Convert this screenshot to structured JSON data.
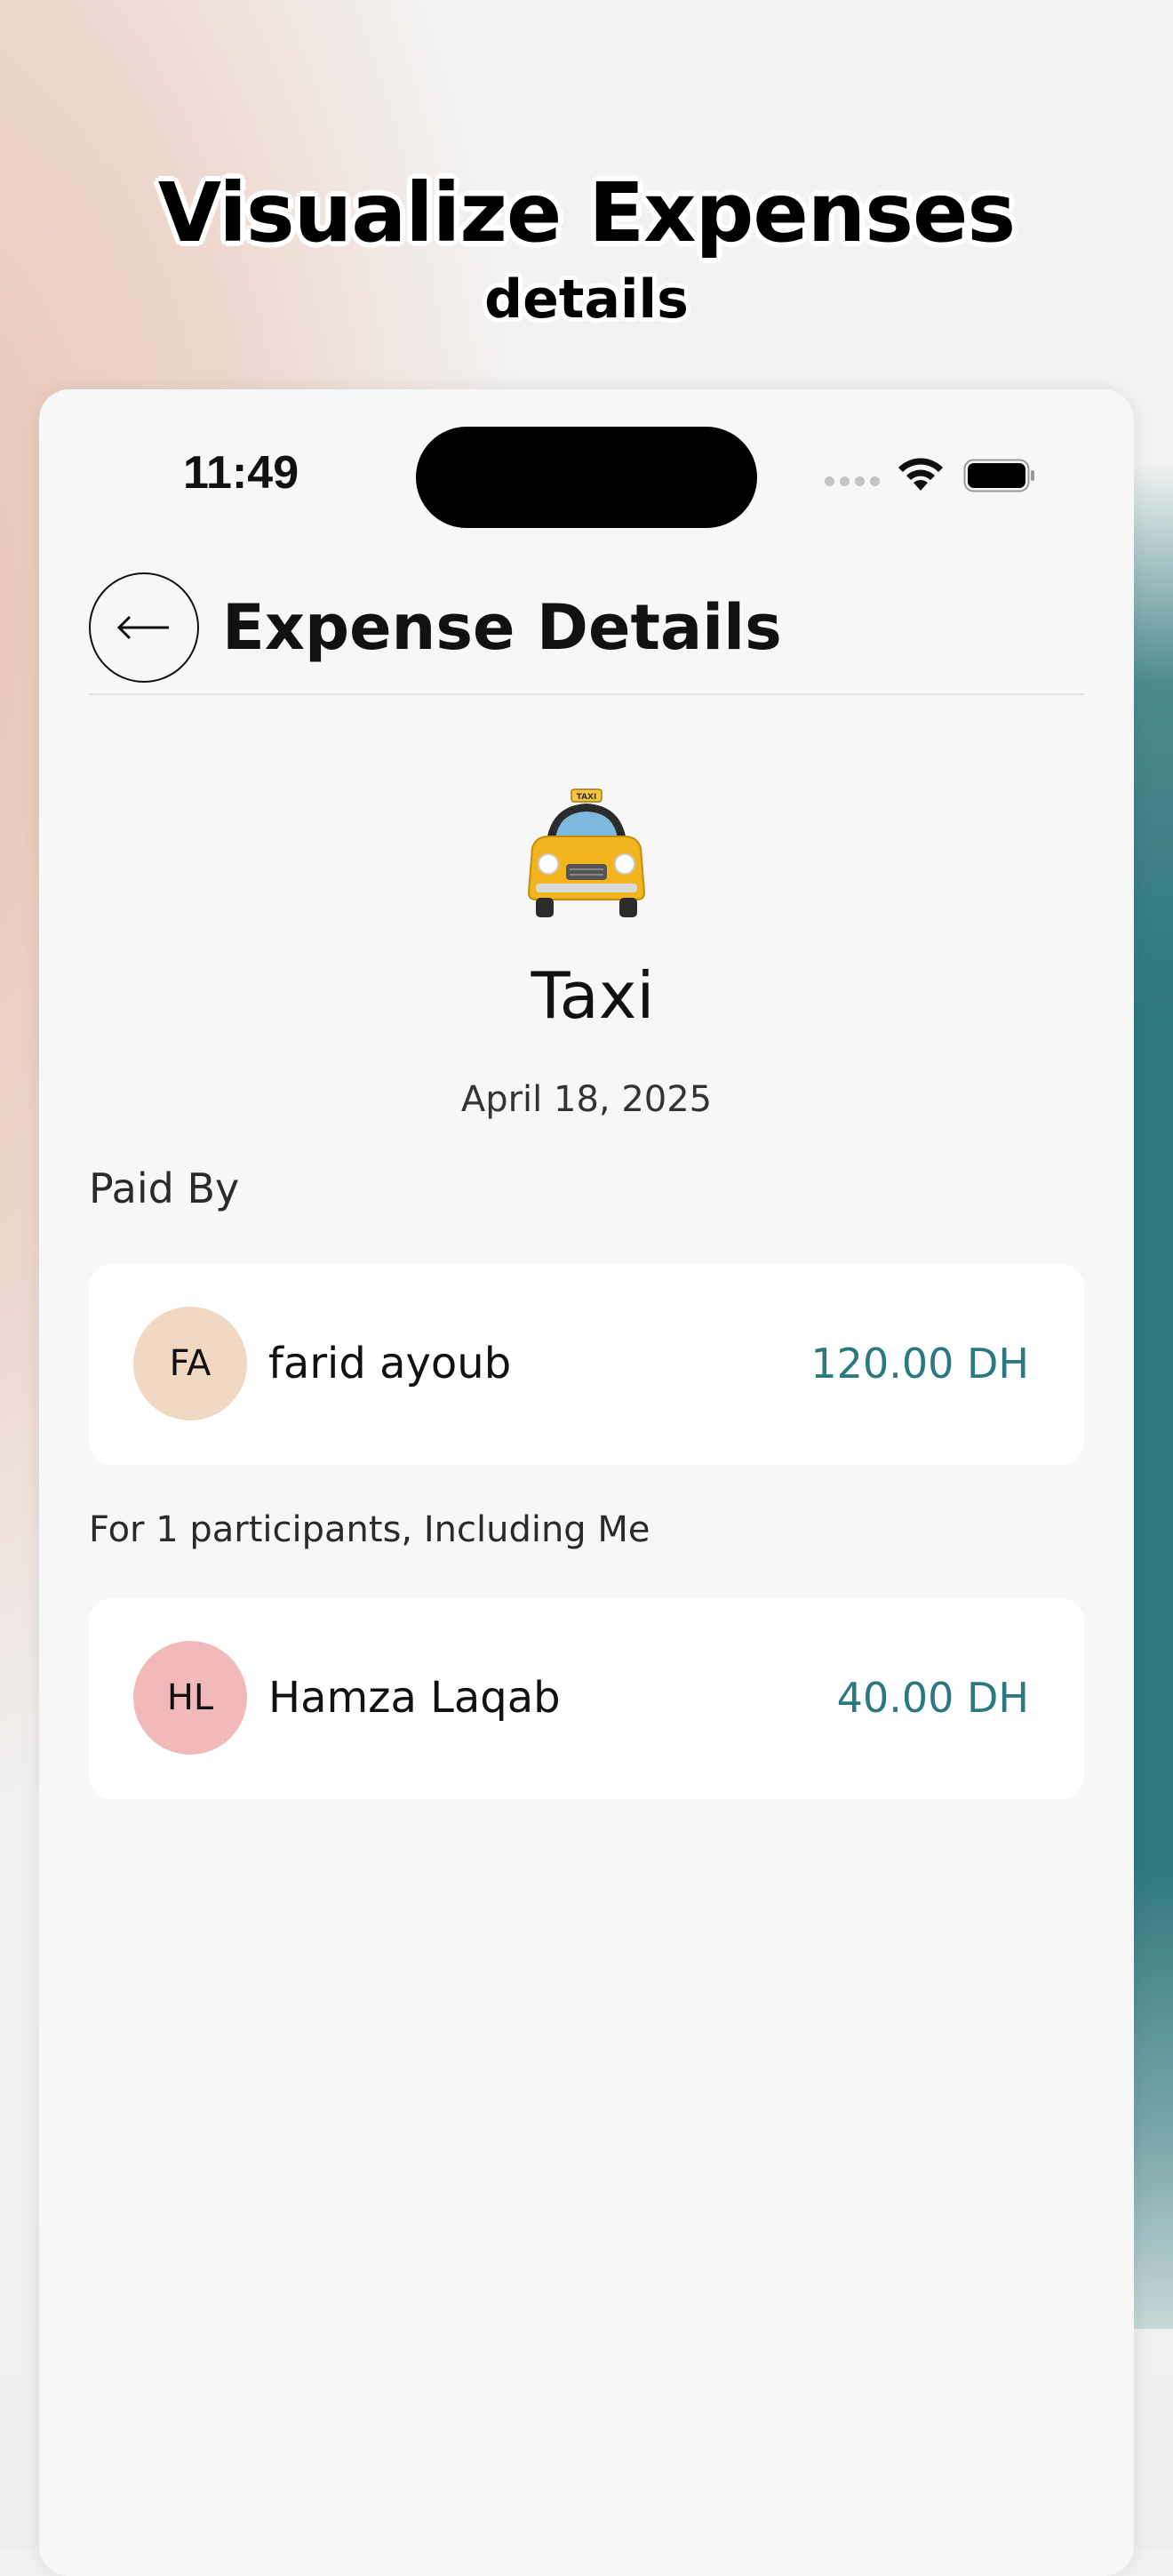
{
  "headline": {
    "title": "Visualize Expenses",
    "subtitle": "details"
  },
  "status_bar": {
    "time": "11:49"
  },
  "nav": {
    "title": "Expense Details"
  },
  "expense": {
    "icon": "taxi-icon",
    "title": "Taxi",
    "date": "April 18, 2025"
  },
  "paid_by": {
    "label": "Paid By",
    "person": {
      "initials": "FA",
      "name": "farid ayoub",
      "amount": "120.00 DH",
      "avatar_color": "#f0d8c2"
    }
  },
  "participants": {
    "label": "For 1 participants, Including Me",
    "items": [
      {
        "initials": "HL",
        "name": "Hamza Laqab",
        "amount": "40.00 DH",
        "avatar_color": "#f1b9b9"
      }
    ]
  },
  "colors": {
    "accent": "#2a7880",
    "background": "#f7f7f7"
  }
}
